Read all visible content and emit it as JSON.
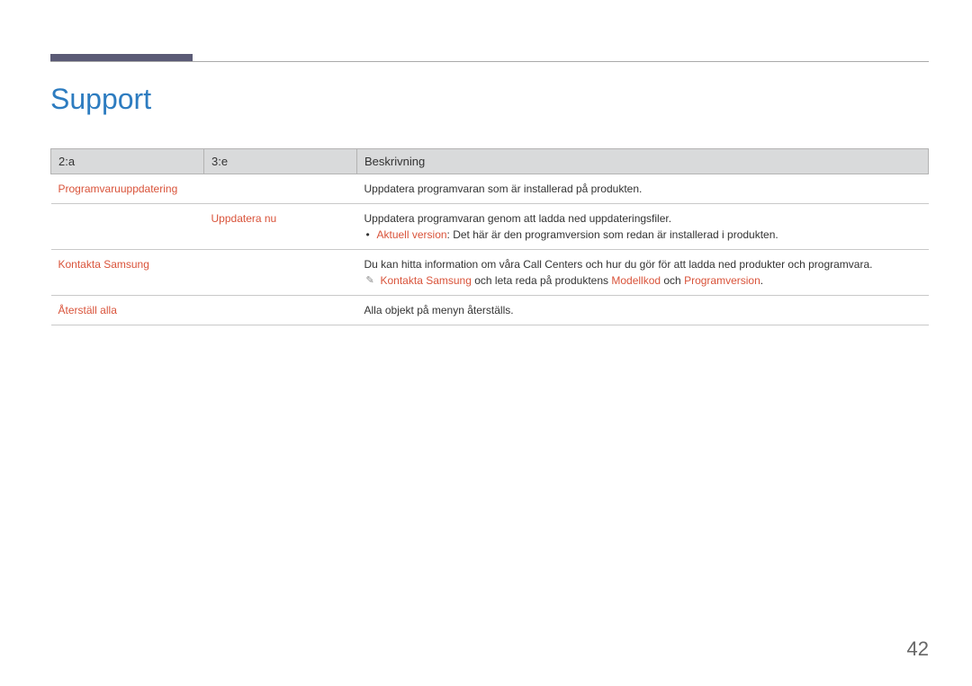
{
  "sectionTitle": "Support",
  "pageNumber": "42",
  "headers": {
    "col1": "2:a",
    "col2": "3:e",
    "col3": "Beskrivning"
  },
  "rows": {
    "r1": {
      "c1": "Programvaruuppdatering",
      "c2": "",
      "c3": "Uppdatera programvaran som är installerad på produkten."
    },
    "r2": {
      "c1": "",
      "c2": "Uppdatera nu",
      "c3_line1": "Uppdatera programvaran genom att ladda ned uppdateringsfiler.",
      "c3_bullet_label": "Aktuell version",
      "c3_bullet_rest": ": Det här är den programversion som redan är installerad i produkten."
    },
    "r3": {
      "c1": "Kontakta Samsung",
      "c2": "",
      "c3_line1": "Du kan hitta information om våra Call Centers och hur du gör för att ladda ned produkter och programvara.",
      "c3_note_a": "Kontakta Samsung",
      "c3_note_mid1": " och leta reda på produktens ",
      "c3_note_b": "Modellkod",
      "c3_note_mid2": " och ",
      "c3_note_c": "Programversion",
      "c3_note_end": "."
    },
    "r4": {
      "c1": "Återställ alla",
      "c2": "",
      "c3": "Alla objekt på menyn återställs."
    }
  }
}
